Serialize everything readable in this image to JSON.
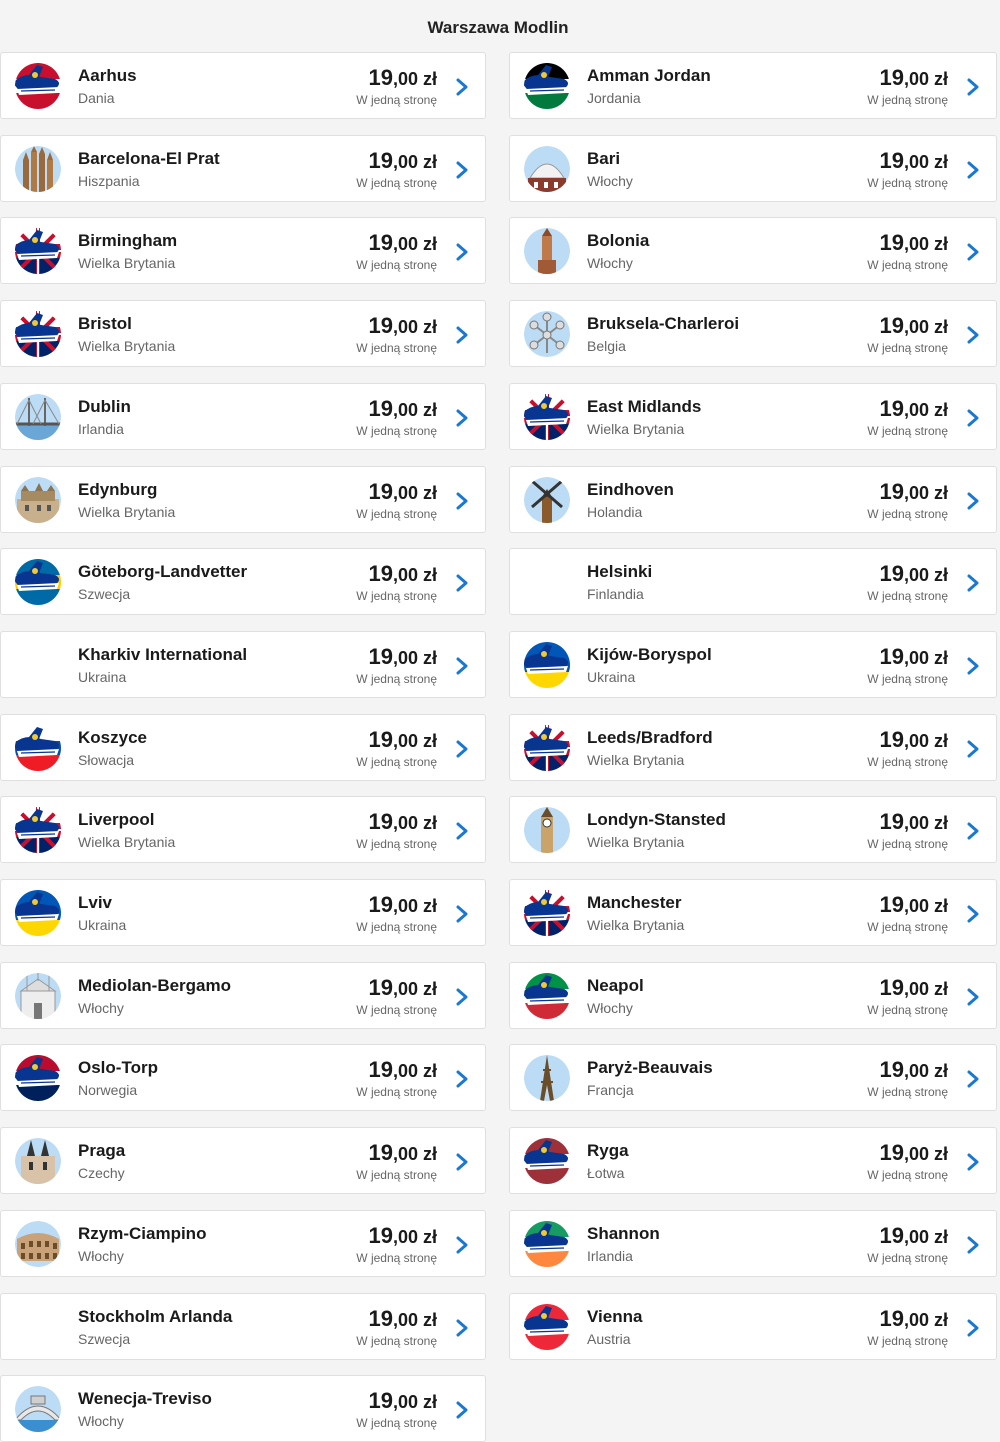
{
  "header": {
    "title": "Warszawa Modlin"
  },
  "price_common": {
    "int": "19",
    "dec": ",00",
    "cur": " zł",
    "way": "W jedną stronę"
  },
  "colors": {
    "accent": "#1a78d2",
    "navy": "#073590",
    "gold": "#f1c933"
  },
  "destinations": [
    {
      "name": "Aarhus",
      "country": "Dania",
      "icon": "plane-flag-dk",
      "col": "left"
    },
    {
      "name": "Amman Jordan",
      "country": "Jordania",
      "icon": "plane-flag-jo",
      "col": "right"
    },
    {
      "name": "Barcelona-El Prat",
      "country": "Hiszpania",
      "icon": "sagrada-familia-icon",
      "col": "left"
    },
    {
      "name": "Bari",
      "country": "Włochy",
      "icon": "dome-icon",
      "col": "right"
    },
    {
      "name": "Birmingham",
      "country": "Wielka Brytania",
      "icon": "plane-flag-uk",
      "col": "left"
    },
    {
      "name": "Bolonia",
      "country": "Włochy",
      "icon": "tower-icon",
      "col": "right"
    },
    {
      "name": "Bristol",
      "country": "Wielka Brytania",
      "icon": "plane-flag-uk",
      "col": "left"
    },
    {
      "name": "Bruksela-Charleroi",
      "country": "Belgia",
      "icon": "atomium-icon",
      "col": "right"
    },
    {
      "name": "Dublin",
      "country": "Irlandia",
      "icon": "bridge-icon",
      "col": "left"
    },
    {
      "name": "East Midlands",
      "country": "Wielka Brytania",
      "icon": "plane-flag-uk",
      "col": "right"
    },
    {
      "name": "Edynburg",
      "country": "Wielka Brytania",
      "icon": "castle-icon",
      "col": "left"
    },
    {
      "name": "Eindhoven",
      "country": "Holandia",
      "icon": "windmill-icon",
      "col": "right"
    },
    {
      "name": "Göteborg-Landvetter",
      "country": "Szwecja",
      "icon": "plane-flag-se",
      "col": "left"
    },
    {
      "name": "Helsinki",
      "country": "Finlandia",
      "icon": "none",
      "col": "right"
    },
    {
      "name": "Kharkiv International",
      "country": "Ukraina",
      "icon": "none",
      "col": "left"
    },
    {
      "name": "Kijów-Boryspol",
      "country": "Ukraina",
      "icon": "plane-flag-ua",
      "col": "right"
    },
    {
      "name": "Koszyce",
      "country": "Słowacja",
      "icon": "plane-flag-sk",
      "col": "left"
    },
    {
      "name": "Leeds/Bradford",
      "country": "Wielka Brytania",
      "icon": "plane-flag-uk",
      "col": "right"
    },
    {
      "name": "Liverpool",
      "country": "Wielka Brytania",
      "icon": "plane-flag-uk",
      "col": "left"
    },
    {
      "name": "Londyn-Stansted",
      "country": "Wielka Brytania",
      "icon": "big-ben-icon",
      "col": "right"
    },
    {
      "name": "Lviv",
      "country": "Ukraina",
      "icon": "plane-flag-ua",
      "col": "left"
    },
    {
      "name": "Manchester",
      "country": "Wielka Brytania",
      "icon": "plane-flag-uk",
      "col": "right"
    },
    {
      "name": "Mediolan-Bergamo",
      "country": "Włochy",
      "icon": "cathedral-icon",
      "col": "left"
    },
    {
      "name": "Neapol",
      "country": "Włochy",
      "icon": "plane-flag-it",
      "col": "right"
    },
    {
      "name": "Oslo-Torp",
      "country": "Norwegia",
      "icon": "plane-flag-no",
      "col": "left"
    },
    {
      "name": "Paryż-Beauvais",
      "country": "Francja",
      "icon": "eiffel-tower-icon",
      "col": "right"
    },
    {
      "name": "Praga",
      "country": "Czechy",
      "icon": "tyn-church-icon",
      "col": "left"
    },
    {
      "name": "Ryga",
      "country": "Łotwa",
      "icon": "plane-flag-lv",
      "col": "right"
    },
    {
      "name": "Rzym-Ciampino",
      "country": "Włochy",
      "icon": "colosseum-icon",
      "col": "left"
    },
    {
      "name": "Shannon",
      "country": "Irlandia",
      "icon": "plane-flag-ie",
      "col": "right"
    },
    {
      "name": "Stockholm Arlanda",
      "country": "Szwecja",
      "icon": "none",
      "col": "left"
    },
    {
      "name": "Vienna",
      "country": "Austria",
      "icon": "plane-flag-at",
      "col": "right"
    },
    {
      "name": "Wenecja-Treviso",
      "country": "Włochy",
      "icon": "rialto-bridge-icon",
      "col": "left"
    }
  ]
}
